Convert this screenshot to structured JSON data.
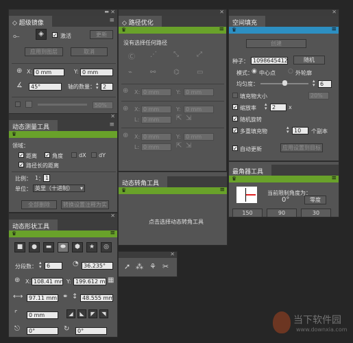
{
  "super_mirror": {
    "title": "超级镜像",
    "live_label": "激活",
    "update_btn": "更新",
    "apply_to_image_btn": "应用到图层",
    "cancel_btn": "取消",
    "x_value": "0 mm",
    "y_value": "0 mm",
    "angle_value": "45°",
    "axis_count_label": "轴的数量：",
    "axis_count_value": "2",
    "percent_value": "50%"
  },
  "path_optimize": {
    "title": "路径优化",
    "no_selection_text": "没有选择任何路径",
    "x_label": "X:",
    "x_value": "0 mm",
    "y_label": "Y:",
    "y_value": "0 mm",
    "l_label": "L:",
    "l_value": "0 mm"
  },
  "space_fill": {
    "title": "空间填充",
    "create_btn": "创建",
    "seed_label": "种子：",
    "seed_value": "1098645412",
    "random_btn": "随机",
    "mode_label": "模式：",
    "mode_center": "中心点",
    "mode_outside": "外轮廓",
    "uniformity_label": "均匀度：",
    "uniformity_value": "6",
    "fill_size_label": "填充物大小",
    "fill_size_value": "20%",
    "scale_rate_label": "缩放率",
    "scale_rate_value": "2",
    "scale_rate_unit": "x",
    "random_rotate_label": "随机旋转",
    "multi_fill_label": "多重填充物",
    "multi_fill_value": "10",
    "multi_fill_unit": "个副本",
    "auto_update_label": "自动更新",
    "apply_to_target_btn": "应用设置到目标"
  },
  "dynamic_measure": {
    "title": "动态测量工具",
    "domain_label": "领域：",
    "distance_label": "距离",
    "angle_label": "角度",
    "dx_label": "dX",
    "dy_label": "dY",
    "path_distance_label": "路径长的距离",
    "scale_label": "比例：",
    "scale_value": "1",
    "scale_sep": "：",
    "scale_value2": "1",
    "unit_label": "单位：",
    "unit_value": "英里（十进制）",
    "delete_all_btn": "全部删除",
    "convert_btn": "转换设置注释为实"
  },
  "dynamic_corner": {
    "title": "动态转角工具",
    "hint_text": "点击选择动态转角工具"
  },
  "chamfer": {
    "title": "最角器工具",
    "max_angle_label": "当前限制角度为：",
    "max_angle_value": "0°",
    "reset_btn": "零度",
    "preset_150": "150",
    "preset_90": "90",
    "preset_30": "30"
  },
  "dynamic_shape": {
    "title": "动态形状工具",
    "segments_label": "分段数：",
    "segments_value": "6",
    "angle_value": "36.235°",
    "x_label": "X:",
    "x_value": "108.41 mm",
    "y_label": "Y:",
    "y_value": "199.612 mm",
    "w_value": "97.11 mm",
    "h_value": "48.555 mm",
    "field1_value": "0 mm",
    "bottom_a": "0°",
    "bottom_b": "0°"
  },
  "watermark": {
    "brand": "当下软件园",
    "url": "www.downxia.com"
  }
}
